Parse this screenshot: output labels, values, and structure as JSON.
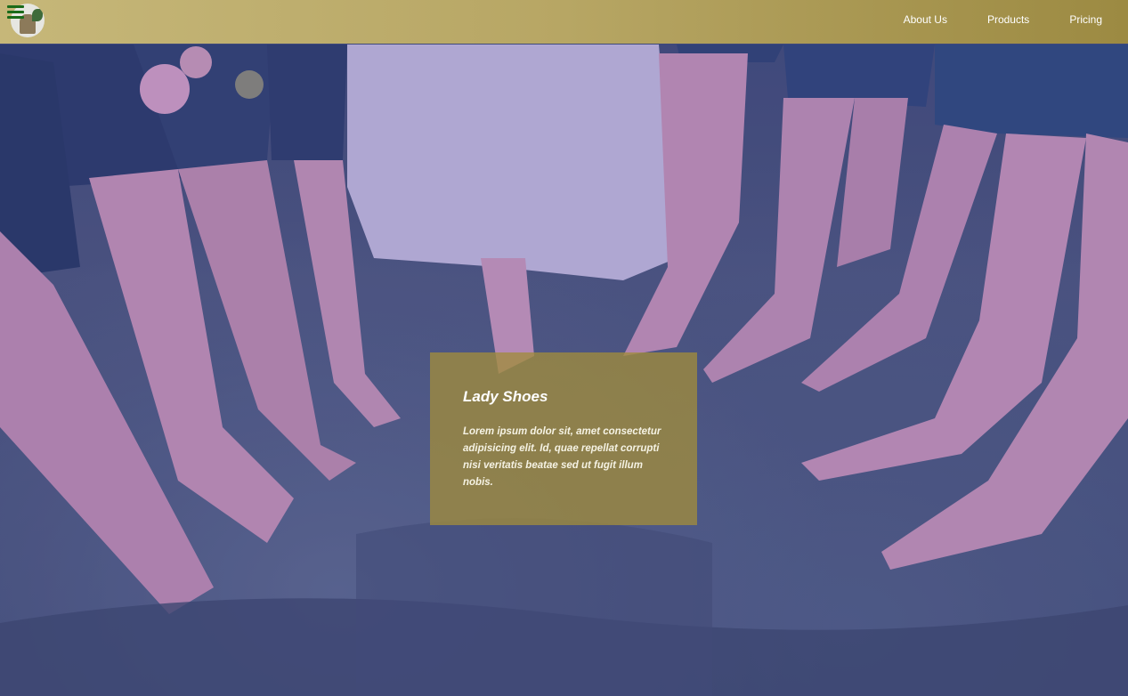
{
  "nav": {
    "links": [
      {
        "label": "About Us"
      },
      {
        "label": "Products"
      },
      {
        "label": "Pricing"
      }
    ]
  },
  "hero": {
    "image": "wedding-party-shoes-on-grass",
    "card": {
      "title": "Lady Shoes",
      "text": "Lorem ipsum dolor sit, amet consectetur adipisicing elit. Id, quae repellat corrupti nisi veritatis beatae sed ut fugit illum nobis."
    }
  },
  "colors": {
    "navbar_start": "#c6b779",
    "navbar_end": "#9c8a42",
    "card_background": "#a08c3c",
    "hamburger": "#1a6b1a"
  }
}
